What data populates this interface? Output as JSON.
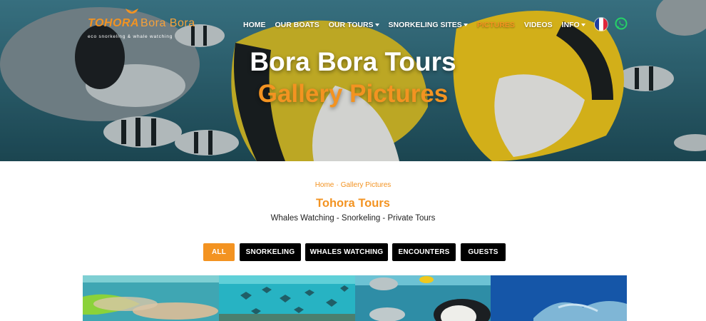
{
  "brand": {
    "name_bold": "TOHORA",
    "name_light": "Bora Bora",
    "tagline": "eco snorkeling & whale watching"
  },
  "nav": {
    "items": [
      {
        "label": "HOME",
        "dropdown": false,
        "active": false
      },
      {
        "label": "OUR BOATS",
        "dropdown": false,
        "active": false
      },
      {
        "label": "OUR TOURS",
        "dropdown": true,
        "active": false
      },
      {
        "label": "SNORKELING SITES",
        "dropdown": true,
        "active": false
      },
      {
        "label": "PICTURES",
        "dropdown": false,
        "active": true
      },
      {
        "label": "VIDEOS",
        "dropdown": false,
        "active": false
      },
      {
        "label": "INFO",
        "dropdown": true,
        "active": false
      }
    ],
    "language_icon": "france-flag-icon",
    "contact_icon": "whatsapp-icon"
  },
  "hero": {
    "title": "Bora Bora Tours",
    "subtitle": "Gallery Pictures"
  },
  "breadcrumb": {
    "home": "Home",
    "current": "Gallery Pictures"
  },
  "section": {
    "title": "Tohora Tours",
    "subtitle": "Whales Watching - Snorkeling - Private Tours"
  },
  "filters": [
    {
      "label": "ALL",
      "active": true
    },
    {
      "label": "SNORKELING",
      "active": false
    },
    {
      "label": "WHALES WATCHING",
      "active": false
    },
    {
      "label": "ENCOUNTERS",
      "active": false
    },
    {
      "label": "GUESTS",
      "active": false
    }
  ],
  "colors": {
    "accent": "#f39321",
    "button_dark": "#000000",
    "text": "#222222"
  }
}
